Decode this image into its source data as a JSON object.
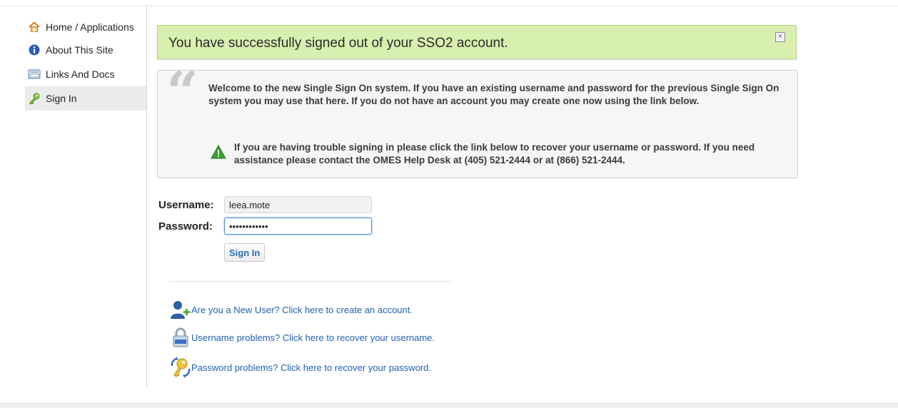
{
  "nav": {
    "items": [
      {
        "label": "Home / Applications",
        "icon": "home-icon"
      },
      {
        "label": "About This Site",
        "icon": "info-icon"
      },
      {
        "label": "Links And Docs",
        "icon": "docs-icon"
      },
      {
        "label": "Sign In",
        "icon": "key-icon",
        "active": true
      }
    ]
  },
  "alert": {
    "message": "You have successfully signed out of your SSO2 account.",
    "close_glyph": "×",
    "color": "#d7f0b0"
  },
  "welcome": {
    "quote_glyph": "“",
    "text": "Welcome to the new Single Sign On system. If you have an existing username and password for the previous Single Sign On system you may use that here. If you do not have an account you may create one now using the link below.",
    "help_text": "If you are having trouble signing in please click the link below to recover your username or password. If you need assistance please contact the OMES Help Desk at (405) 521-2444 or at (866) 521-2444."
  },
  "form": {
    "username_label": "Username:",
    "username_value": "leea.mote",
    "password_label": "Password:",
    "password_value": "••••••••••••",
    "submit_label": "Sign In"
  },
  "links": [
    {
      "label": "Are you a New User? Click here to create an account.",
      "icon": "add-user-icon"
    },
    {
      "label": "Username problems? Click here to recover your username.",
      "icon": "lock-icon"
    },
    {
      "label": "Password problems? Click here to recover your password.",
      "icon": "key-recover-icon"
    }
  ],
  "colors": {
    "link": "#2360b5",
    "accent": "#4a8fe0"
  }
}
